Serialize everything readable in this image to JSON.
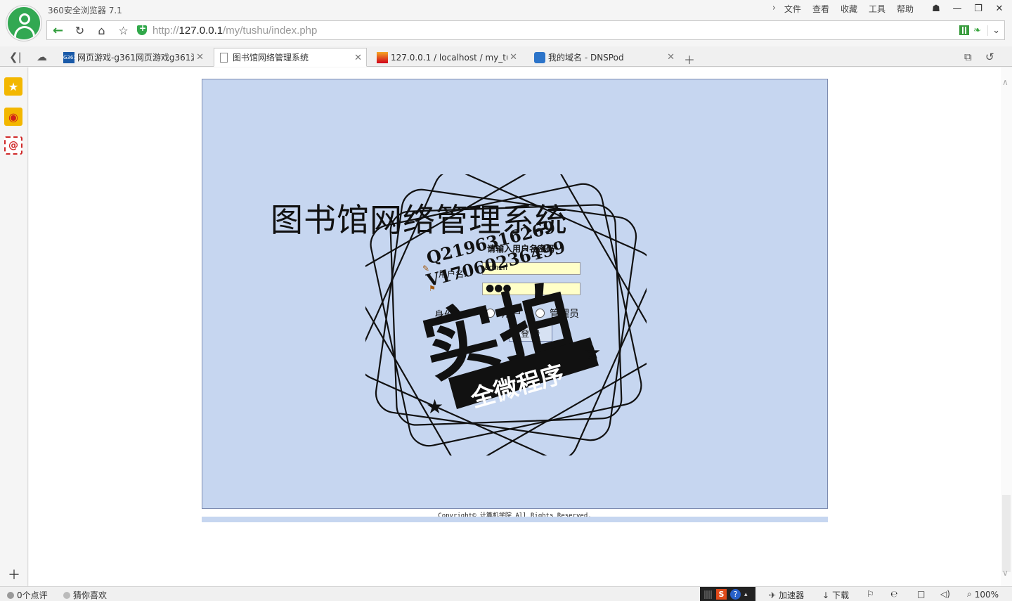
{
  "browser": {
    "title": "360安全浏览器 7.1",
    "menu": [
      "文件",
      "查看",
      "收藏",
      "工具",
      "帮助"
    ],
    "url_scheme_prefix": "http://",
    "url_host": "127.0.0.1",
    "url_path": "/my/tushu/index.php"
  },
  "tabs": [
    {
      "label": "网页游戏-g361网页游戏g361游",
      "favicon": "g361-icon",
      "favicon_text": "G361",
      "active": false
    },
    {
      "label": "图书馆网络管理系统",
      "favicon": "document-icon",
      "active": true
    },
    {
      "label": "127.0.0.1 / localhost / my_tu",
      "favicon": "phpmyadmin-icon",
      "favicon_text": "PMA",
      "active": false
    },
    {
      "label": "我的域名 - DNSPod",
      "favicon": "dnspod-icon",
      "active": false
    }
  ],
  "page": {
    "system_title": "图书馆网络管理系统",
    "prompt": "请输入用户名密码",
    "username_label": "用户名:",
    "username_value": "admin",
    "password_value": "●●●",
    "role_label": "身份",
    "role_user": "用户",
    "role_admin": "管理员",
    "login_button": "登 录",
    "copyright": "Copyright© 计算机学院 All Rights Reserved."
  },
  "watermark": {
    "line1": "Q2196316269",
    "line2": "V17060236499",
    "main": "实拍",
    "banner": "全微程序"
  },
  "statusbar": {
    "comments": "0个点评",
    "guess": "猜你喜欢",
    "accelerator": "加速器",
    "download": "下载",
    "zoom": "100%",
    "ime_s": "S",
    "ime_q": "?"
  }
}
